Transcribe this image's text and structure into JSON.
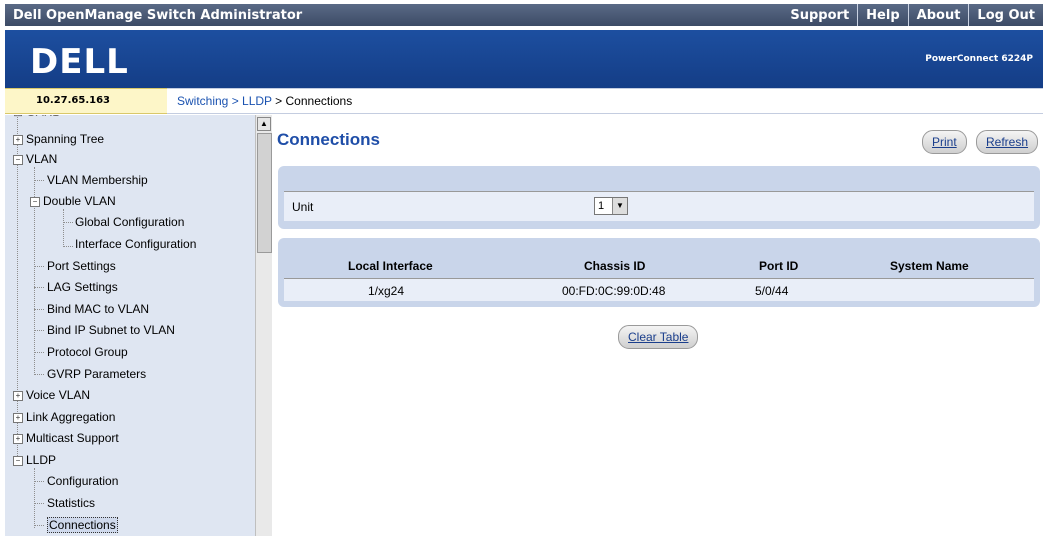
{
  "app": {
    "title": "Dell OpenManage Switch Administrator",
    "links": [
      "Support",
      "Help",
      "About",
      "Log Out"
    ],
    "logo": "DELL",
    "model": "PowerConnect 6224P"
  },
  "ip_address": "10.27.65.163",
  "breadcrumb": {
    "link": "Switching > LLDP",
    "current": " > Connections"
  },
  "sidebar": {
    "items": [
      "Spanning Tree",
      "VLAN",
      "VLAN Membership",
      "Double VLAN",
      "Global Configuration",
      "Interface Configuration",
      "Port Settings",
      "LAG Settings",
      "Bind MAC to VLAN",
      "Bind IP Subnet to VLAN",
      "Protocol Group",
      "GVRP Parameters",
      "Voice VLAN",
      "Link Aggregation",
      "Multicast Support",
      "LLDP",
      "Configuration",
      "Statistics",
      "Connections"
    ]
  },
  "page": {
    "title": "Connections",
    "print_label": "Print",
    "refresh_label": "Refresh",
    "unit_label": "Unit",
    "unit_value": "1",
    "clear_label": "Clear Table"
  },
  "table": {
    "headers": [
      "Local Interface",
      "Chassis ID",
      "Port ID",
      "System Name"
    ],
    "rows": [
      [
        "1/xg24",
        "00:FD:0C:99:0D:48",
        "5/0/44",
        ""
      ]
    ]
  }
}
